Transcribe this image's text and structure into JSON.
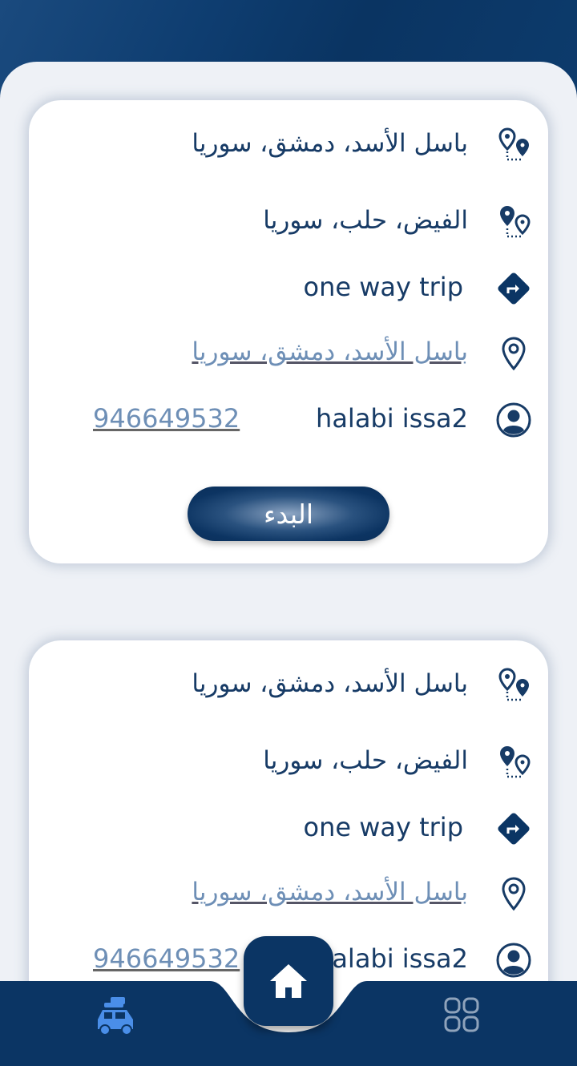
{
  "trips": [
    {
      "from": "باسل الأسد، دمشق، سوريا",
      "to": "الفيض، حلب، سوريا",
      "trip_type": "one way trip",
      "location_link": "باسل الأسد، دمشق، سوريا",
      "driver_name": "halabi issa2",
      "phone": "946649532",
      "start_label": "البدء"
    },
    {
      "from": "باسل الأسد، دمشق، سوريا",
      "to": "الفيض، حلب، سوريا",
      "trip_type": "one way trip",
      "location_link": "باسل الأسد، دمشق، سوريا",
      "driver_name": "halabi issa2",
      "phone": "946649532"
    }
  ],
  "icons": {
    "route": "route-pin-icon",
    "trip_type": "turn-right-diamond-icon",
    "location": "location-pin-outline-icon",
    "user": "user-circle-icon",
    "nav_trips": "car-with-luggage-icon",
    "nav_home": "home-icon",
    "nav_menu": "grid-menu-icon"
  },
  "colors": {
    "primary": "#0b3564",
    "text": "#173b66",
    "link": "#6e8fb6",
    "background": "#eef1f6",
    "active_nav": "#4a8ee8",
    "inactive_nav": "#8fa3bb"
  }
}
